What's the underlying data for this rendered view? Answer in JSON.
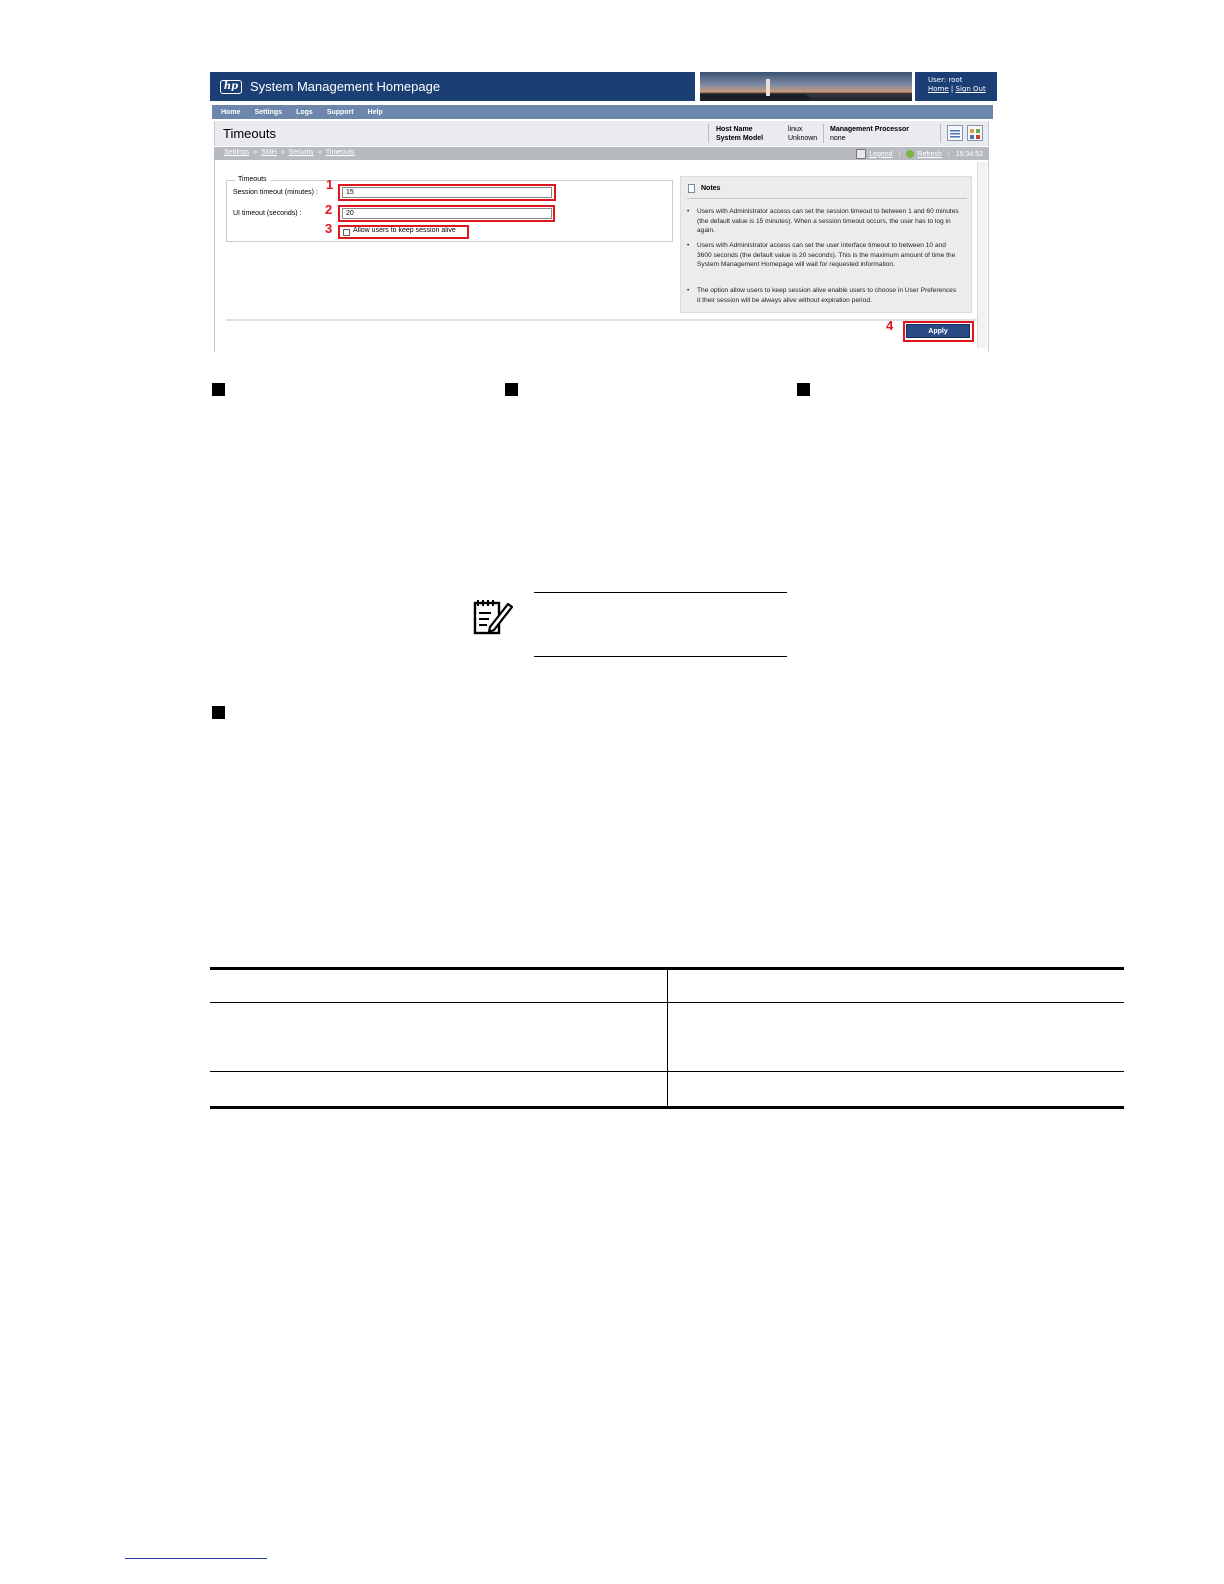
{
  "app": {
    "title": "System Management Homepage",
    "logo": "hp-logo",
    "logo_text": "hp",
    "user_label": "User: root",
    "home_link": "Home",
    "link_separator": "|",
    "signout_link": "Sign Out"
  },
  "nav": [
    "Home",
    "Settings",
    "Logs",
    "Support",
    "Help"
  ],
  "page": {
    "title": "Timeouts",
    "host_name_label": "Host Name",
    "host_name_value": "linux",
    "system_model_label": "System Model",
    "system_model_value": "Unknown",
    "mp_label": "Management Processor",
    "mp_value": "none"
  },
  "breadcrumb": [
    "Settings",
    "SMH",
    "Security",
    "Timeouts"
  ],
  "breadcrumb_separator": "»",
  "toolbar": {
    "legend": "Legend",
    "refresh": "Refresh",
    "time": "15:34:52"
  },
  "form": {
    "group_title": "Timeouts",
    "session_label": "Session timeout (minutes) :",
    "session_value": "15",
    "ui_label": "UI timeout (seconds) :",
    "ui_value": "20",
    "keepalive_label": "Allow users to keep session alive",
    "keepalive_checked": false,
    "apply_label": "Apply"
  },
  "callouts": [
    "1",
    "2",
    "3",
    "4"
  ],
  "notes": {
    "title": "Notes",
    "items": [
      "Users with Administrator access can set the session timeout to between 1 and 60 minutes (the default value is 15 minutes). When a session timeout occurs, the user has to log in again.",
      "Users with Administrator access can set the user interface timeout to between 10 and 3600 seconds (the default value is 20 seconds). This is the maximum amount of time the System Management Homepage will wait for requested information.",
      "The option allow users to keep session alive enable users to choose in User Preferences it their session will be always alive without expiration period."
    ]
  },
  "colors": {
    "banner": "#1b3f74",
    "nav": "#6d86ab",
    "callout": "#e0161e",
    "apply": "#2a4a86"
  },
  "icons": {
    "note": "note-pencil-icon",
    "legend": "legend-icon",
    "refresh": "refresh-icon",
    "notes": "document-icon"
  }
}
